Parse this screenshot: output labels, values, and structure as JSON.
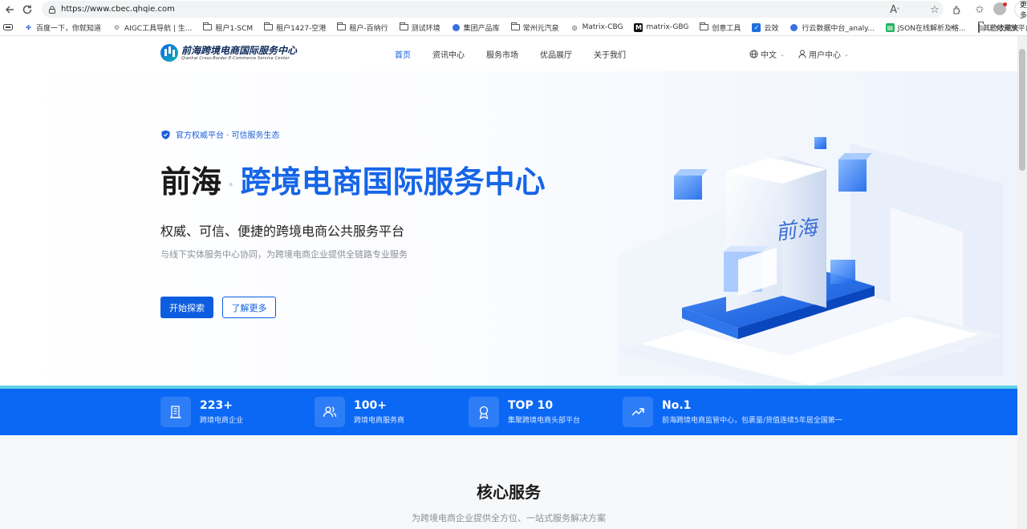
{
  "browser": {
    "url": "https://www.cbec.qhqie.com",
    "more_label": "更多",
    "bookmarks": [
      {
        "label": "百度一下，你就知道",
        "icon": "paw-icon"
      },
      {
        "label": "AIGC工具导航 | 生...",
        "icon": "gear-icon"
      },
      {
        "label": "租户1-SCM",
        "icon": "folder-icon"
      },
      {
        "label": "租户1427-空港",
        "icon": "folder-icon"
      },
      {
        "label": "租户-百纳行",
        "icon": "folder-icon"
      },
      {
        "label": "测试环境",
        "icon": "folder-icon"
      },
      {
        "label": "集团产品库",
        "icon": "site-icon"
      },
      {
        "label": "常州元汽泉",
        "icon": "folder-icon"
      },
      {
        "label": "Matrix-CBG",
        "icon": "globe-icon"
      },
      {
        "label": "matrix-GBG",
        "icon": "m-icon"
      },
      {
        "label": "创意工具",
        "icon": "folder-icon"
      },
      {
        "label": "云效",
        "icon": "check-icon"
      },
      {
        "label": "行云数据中台_analy...",
        "icon": "site-icon"
      },
      {
        "label": "JSON在线解析及格...",
        "icon": "json-icon"
      },
      {
        "label": "汇付开放平台",
        "icon": "globe-icon"
      }
    ],
    "other_bookmarks": "其他收藏夹"
  },
  "header": {
    "logo_cn": "前海跨境电商国际服务中心",
    "logo_en": "Qianhai Cross-Border E-Commerce Service Center",
    "nav": [
      "首页",
      "资讯中心",
      "服务市场",
      "优品展厅",
      "关于我们"
    ],
    "active_nav": "首页",
    "language": "中文",
    "user_center": "用户中心"
  },
  "hero": {
    "badge": "官方权威平台 · 可信服务生态",
    "title_dark": "前海",
    "title_sep": "·",
    "title_blue": "跨境电商国际服务中心",
    "subtitle": "权威、可信、便捷的跨境电商公共服务平台",
    "description": "与线下实体服务中心协同，为跨境电商企业提供全链路专业服务",
    "primary_button": "开始探索",
    "secondary_button": "了解更多",
    "art_text": "前海"
  },
  "stats": [
    {
      "value": "223+",
      "label": "跨境电商企业",
      "icon": "building-icon"
    },
    {
      "value": "100+",
      "label": "跨境电商服务商",
      "icon": "users-icon"
    },
    {
      "value": "TOP 10",
      "label": "集聚跨境电商头部平台",
      "icon": "award-icon"
    },
    {
      "value": "No.1",
      "label": "前海跨境电商监管中心，包裹量/货值连续5年居全国第一",
      "icon": "trend-up-icon"
    }
  ],
  "core": {
    "title": "核心服务",
    "subtitle": "为跨境电商企业提供全方位、一站式服务解决方案"
  },
  "colors": {
    "brand_blue": "#0c5de0",
    "stats_band": "#0b68f5",
    "stats_accent": "#5fd3e4"
  }
}
